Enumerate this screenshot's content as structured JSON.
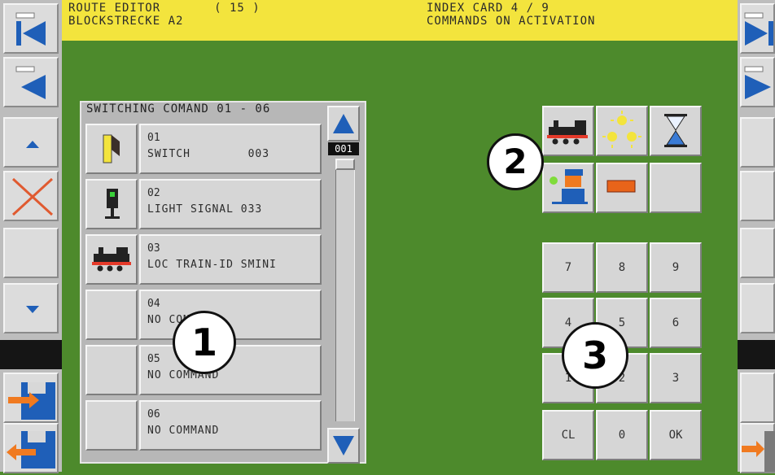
{
  "header": {
    "left_line1": "ROUTE EDITOR       ( 15 )",
    "left_line2": "BLOCKSTRECKE A2",
    "right_line1": "INDEX CARD 4 / 9",
    "right_line2": "COMMANDS ON ACTIVATION"
  },
  "left_toolbar": [
    "first-page-icon",
    "previous-page-icon",
    "scroll-up-icon",
    "delete-icon",
    "empty",
    "scroll-down-icon",
    "save-icon",
    "load-icon"
  ],
  "right_toolbar": [
    "last-page-icon",
    "next-page-icon",
    "empty",
    "empty",
    "empty",
    "empty",
    "empty",
    "exit-icon"
  ],
  "switching": {
    "title": "SWITCHING COMAND 01 - 06",
    "scroll_counter": "001",
    "commands": [
      {
        "num": "01",
        "text": "SWITCH        003",
        "icon": "turnout-icon"
      },
      {
        "num": "02",
        "text": "LIGHT SIGNAL 033",
        "icon": "light-signal-icon"
      },
      {
        "num": "03",
        "text": "LOC TRAIN-ID SMINI",
        "icon": "locomotive-icon"
      },
      {
        "num": "04",
        "text": "NO COMMAND",
        "icon": "none"
      },
      {
        "num": "05",
        "text": "NO COMMAND",
        "icon": "none"
      },
      {
        "num": "06",
        "text": "NO COMMAND",
        "icon": "none"
      }
    ]
  },
  "command_types": [
    "locomotive-icon",
    "light-function-icon",
    "hourglass-icon",
    "operator-icon",
    "stop-icon",
    "empty"
  ],
  "keypad": [
    "7",
    "8",
    "9",
    "4",
    "5",
    "6",
    "1",
    "2",
    "3",
    "CL",
    "0",
    "OK"
  ],
  "badges": [
    "1",
    "2",
    "3"
  ],
  "colors": {
    "background": "#4d8a2c",
    "header": "#f3e43d",
    "panel": "#b7b7b7",
    "arrow_blue": "#1f5fb8",
    "delete_red": "#e05a30"
  }
}
